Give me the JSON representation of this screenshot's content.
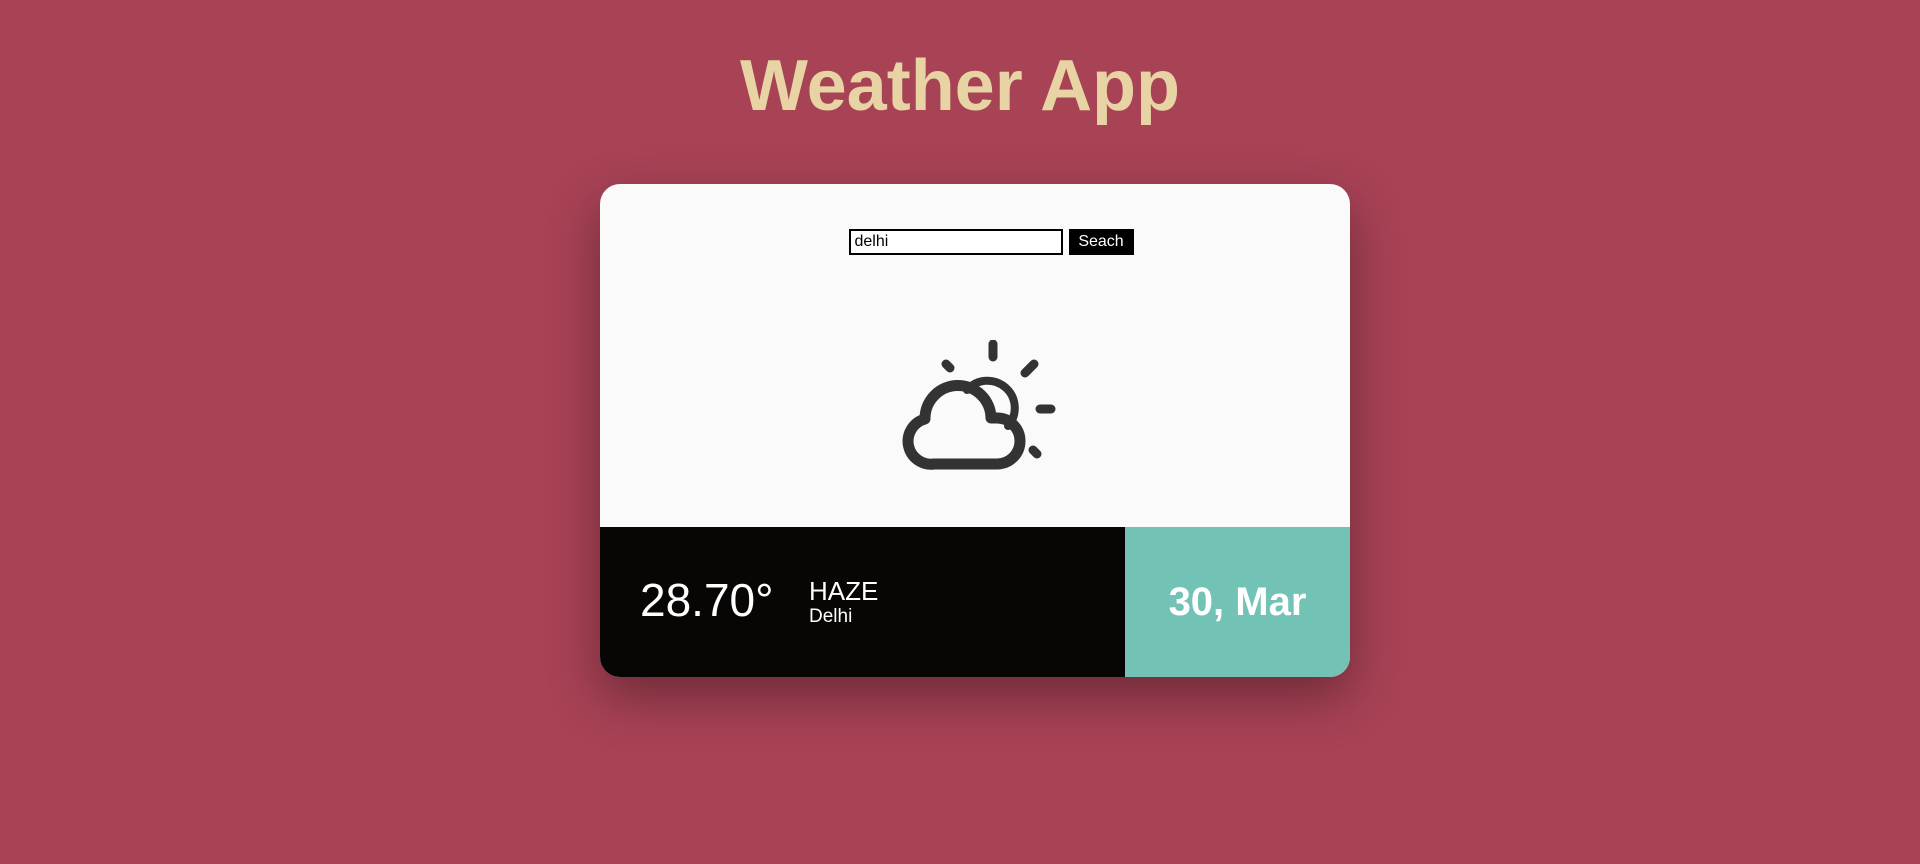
{
  "app": {
    "title": "Weather App"
  },
  "search": {
    "value": "delhi",
    "button_label": "Seach"
  },
  "weather": {
    "icon": "partly-cloudy-icon",
    "temperature": "28.70°",
    "condition": "HAZE",
    "city": "Delhi",
    "date": "30, Mar"
  },
  "colors": {
    "background": "#a84255",
    "title": "#e8d3a5",
    "card": "#fafafa",
    "info_panel": "#070604",
    "date_panel": "#72c2b5",
    "icon": "#333333"
  }
}
